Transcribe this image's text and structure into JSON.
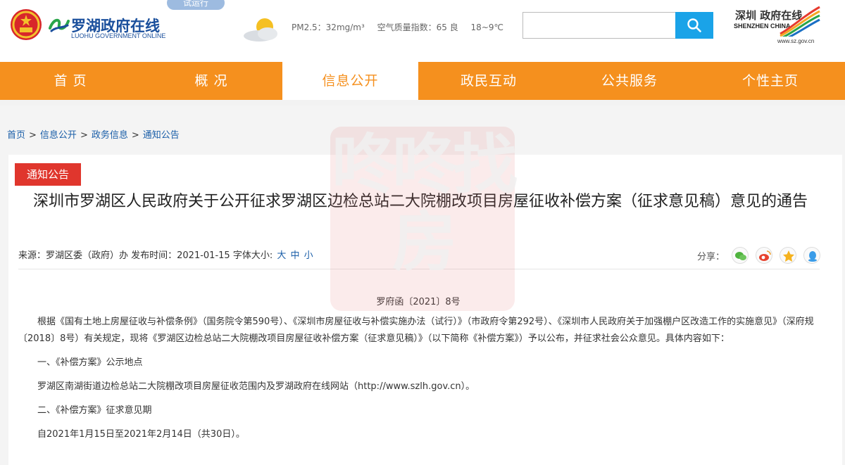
{
  "header": {
    "logo_cn": "罗湖政府在线",
    "logo_en": "LUOHU GOVERNMENT ONLINE",
    "trial_badge": "试运行",
    "weather": {
      "pm25": "PM2.5：32mg/m³",
      "aqi": "空气质量指数：65 良",
      "temp": "18~9℃"
    },
    "search": {
      "placeholder": ""
    },
    "sz_logo": {
      "cn": "深圳 政府在线",
      "en": "SHENZHEN CHINA",
      "url": "www.sz.gov.cn"
    }
  },
  "nav": {
    "items": [
      {
        "label": "首 页"
      },
      {
        "label": "概 况"
      },
      {
        "label": "信息公开"
      },
      {
        "label": "政民互动"
      },
      {
        "label": "公共服务"
      },
      {
        "label": "个性主页"
      }
    ]
  },
  "breadcrumb": {
    "items": [
      "首页",
      "信息公开",
      "政务信息",
      "通知公告"
    ],
    "sep": ">"
  },
  "article": {
    "tag": "通知公告",
    "title": "深圳市罗湖区人民政府关于公开征求罗湖区边检总站二大院棚改项目房屋征收补偿方案（征求意见稿）意见的通告",
    "meta": "来源：罗湖区委（政府）办  发布时间：2021-01-15 字体大小:",
    "font_sizes": [
      "大",
      "中",
      "小"
    ],
    "share_label": "分享：",
    "doc_no": "罗府函〔2021〕8号",
    "paragraphs": [
      "根据《国有土地上房屋征收与补偿条例》（国务院令第590号）、《深圳市房屋征收与补偿实施办法（试行）》（市政府令第292号）、《深圳市人民政府关于加强棚户区改造工作的实施意见》（深府规〔2018〕8号）有关规定，现将《罗湖区边检总站二大院棚改项目房屋征收补偿方案（征求意见稿）》（以下简称《补偿方案》）予以公布，并征求社会公众意见。具体内容如下：",
      "一、《补偿方案》公示地点",
      "罗湖区南湖街道边检总站二大院棚改项目房屋征收范围内及罗湖政府在线网站（http://www.szlh.gov.cn）。",
      "二、《补偿方案》征求意见期",
      "自2021年1月15日至2021年2月14日（共30日）。"
    ]
  },
  "watermark": {
    "text": "咚咚找房"
  }
}
